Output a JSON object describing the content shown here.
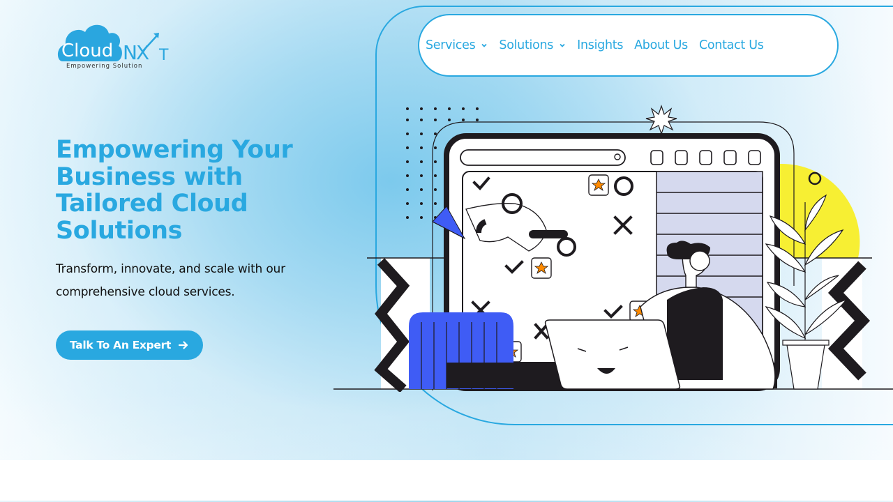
{
  "brand": {
    "name_part1": "Cloud",
    "name_part2": "NX",
    "name_part3": "T",
    "tagline": "Empowering Solution",
    "primary_color": "#29a8e0"
  },
  "nav": {
    "items": [
      {
        "label": "Services",
        "has_dropdown": true
      },
      {
        "label": "Solutions",
        "has_dropdown": true
      },
      {
        "label": "Insights",
        "has_dropdown": false
      },
      {
        "label": "About Us",
        "has_dropdown": false
      },
      {
        "label": "Contact Us",
        "has_dropdown": false
      }
    ]
  },
  "hero": {
    "headline_lines": [
      "Empowering Your",
      "Business with",
      "Tailored Cloud",
      "Solutions"
    ],
    "subtext_lines": [
      "Transform, innovate, and scale with our",
      "comprehensive cloud services."
    ],
    "cta_label": "Talk To An Expert",
    "cta_icon": "arrow-right-icon"
  },
  "illustration": {
    "description": "person at laptop in front of large browser window with checklist, stars and plant",
    "accent_colors": {
      "blue": "#3f5cf5",
      "yellow": "#f7ef33",
      "orange": "#ff8a00",
      "lavender": "#d5d9ee",
      "ink": "#1e1b1f"
    }
  }
}
